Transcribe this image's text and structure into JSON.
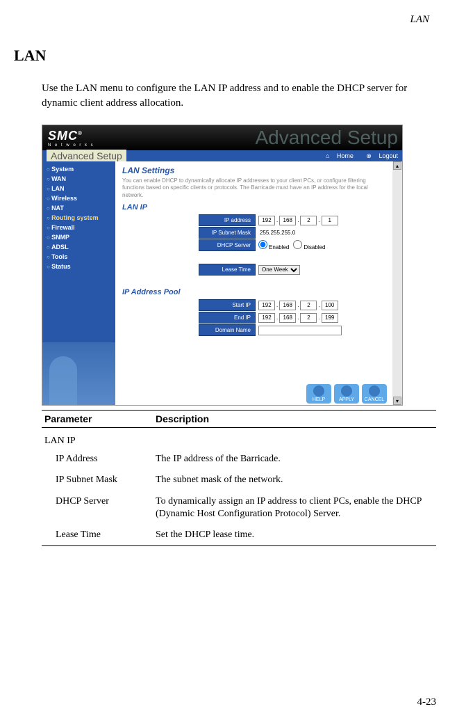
{
  "header": {
    "label": "LAN"
  },
  "section": {
    "title": "LAN"
  },
  "intro": "Use the LAN menu to configure the LAN IP address and to enable the DHCP server for dynamic client address allocation.",
  "screenshot": {
    "logo": {
      "main": "SMC",
      "reg": "®",
      "sub": "N e t w o r k s"
    },
    "watermark": "Advanced Setup",
    "topbar": {
      "title": "Advanced Setup",
      "home_icon": "⌂",
      "home": "Home",
      "logout_icon": "⊗",
      "logout": "Logout"
    },
    "sidebar": [
      {
        "label": "System",
        "hl": false
      },
      {
        "label": "WAN",
        "hl": false
      },
      {
        "label": "LAN",
        "hl": false
      },
      {
        "label": "Wireless",
        "hl": false
      },
      {
        "label": "NAT",
        "hl": false
      },
      {
        "label": "Routing system",
        "hl": true
      },
      {
        "label": "Firewall",
        "hl": false
      },
      {
        "label": "SNMP",
        "hl": false
      },
      {
        "label": "ADSL",
        "hl": false
      },
      {
        "label": "Tools",
        "hl": false
      },
      {
        "label": "Status",
        "hl": false
      }
    ],
    "main": {
      "title": "LAN Settings",
      "desc": "You can enable DHCP to dynamically allocate IP addresses to your client PCs, or configure filtering functions based on specific clients or protocols. The Barricade must have an IP address for the local network.",
      "lan_ip": {
        "title": "LAN IP",
        "rows": {
          "ip_address": {
            "label": "IP address",
            "v": [
              "192",
              "168",
              "2",
              "1"
            ]
          },
          "subnet": {
            "label": "IP Subnet Mask",
            "value": "255.255.255.0"
          },
          "dhcp": {
            "label": "DHCP Server",
            "enabled": "Enabled",
            "disabled": "Disabled"
          }
        }
      },
      "lease": {
        "label": "Lease Time",
        "value": "One Week"
      },
      "pool": {
        "title": "IP Address Pool",
        "start": {
          "label": "Start IP",
          "v": [
            "192",
            "168",
            "2",
            "100"
          ]
        },
        "end": {
          "label": "End IP",
          "v": [
            "192",
            "168",
            "2",
            "199"
          ]
        },
        "domain": {
          "label": "Domain Name",
          "value": ""
        }
      },
      "actions": {
        "help": "HELP",
        "apply": "APPLY",
        "cancel": "CANCEL"
      }
    }
  },
  "table": {
    "headers": {
      "param": "Parameter",
      "desc": "Description"
    },
    "group": "LAN IP",
    "rows": [
      {
        "p": "IP Address",
        "d": "The IP address of the Barricade."
      },
      {
        "p": "IP Subnet Mask",
        "d": "The subnet mask of the network."
      },
      {
        "p": "DHCP Server",
        "d": "To dynamically assign an IP address to client PCs, enable the DHCP (Dynamic Host Configuration Protocol) Server."
      },
      {
        "p": "Lease Time",
        "d": "Set the DHCP lease time."
      }
    ]
  },
  "page_number": "4-23"
}
